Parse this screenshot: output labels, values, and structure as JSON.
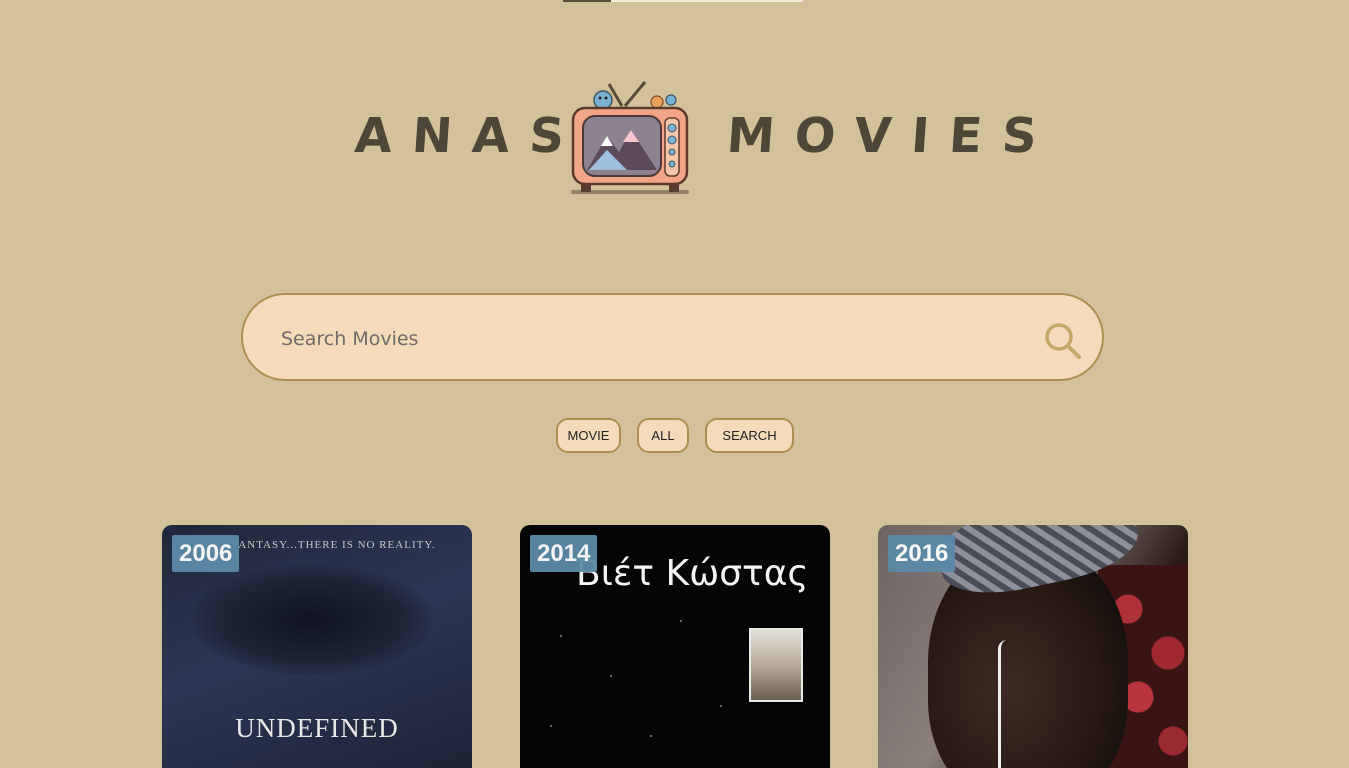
{
  "header": {
    "logo_left": "ANAS",
    "logo_right": "MOVIES"
  },
  "search": {
    "placeholder": "Search Movies"
  },
  "filters": {
    "movie_label": "MOVIE",
    "all_label": "ALL",
    "search_label": "SEARCH"
  },
  "movies": [
    {
      "year": "2006",
      "poster_top_text": "FANTASY...THERE IS NO REALITY.",
      "poster_title": "UNDEFINED"
    },
    {
      "year": "2014",
      "poster_title": "Βιέτ Κώστας"
    },
    {
      "year": "2016"
    }
  ],
  "colors": {
    "background": "#d3c19c",
    "field": "#f4dbbc",
    "border": "#ab9051",
    "badge": "#5c8aa8"
  },
  "icons": [
    "search-icon",
    "tv-logo-icon"
  ]
}
